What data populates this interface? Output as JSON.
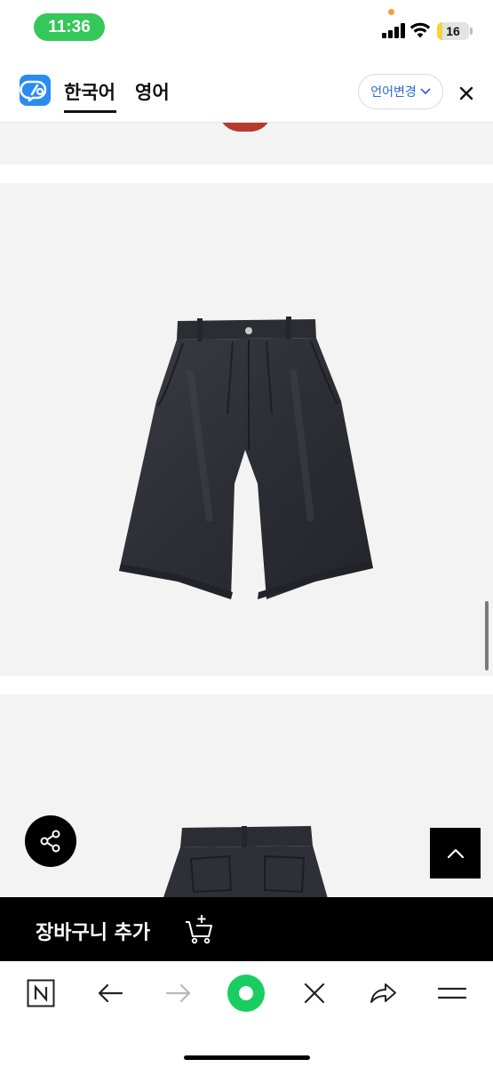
{
  "status_bar": {
    "time": "11:36",
    "battery_level": "16",
    "battery_fraction": 0.16,
    "icons": [
      "cellular-signal-icon",
      "wifi-icon",
      "battery-icon"
    ]
  },
  "translate_bar": {
    "logo_icon": "papago-icon",
    "tab_source": "한국어",
    "tab_target": "영어",
    "change_language_label": "언어변경",
    "close_icon": "close-icon",
    "accent_color": "#2a6bd8"
  },
  "product": {
    "image_1": "denim-shorts-front-photo",
    "image_2": "denim-shorts-back-photo"
  },
  "floating": {
    "share_icon": "share-icon",
    "scroll_top_icon": "chevron-up-icon"
  },
  "cart_bar": {
    "label": "장바구니 추가",
    "icon": "add-to-cart-icon"
  },
  "browser_toolbar": {
    "buttons": [
      "naver-home-icon",
      "back-arrow-icon",
      "forward-arrow-icon",
      "green-dot-menu-icon",
      "close-tab-icon",
      "share-arrow-icon",
      "menu-icon"
    ],
    "green_color": "#19ce60"
  }
}
